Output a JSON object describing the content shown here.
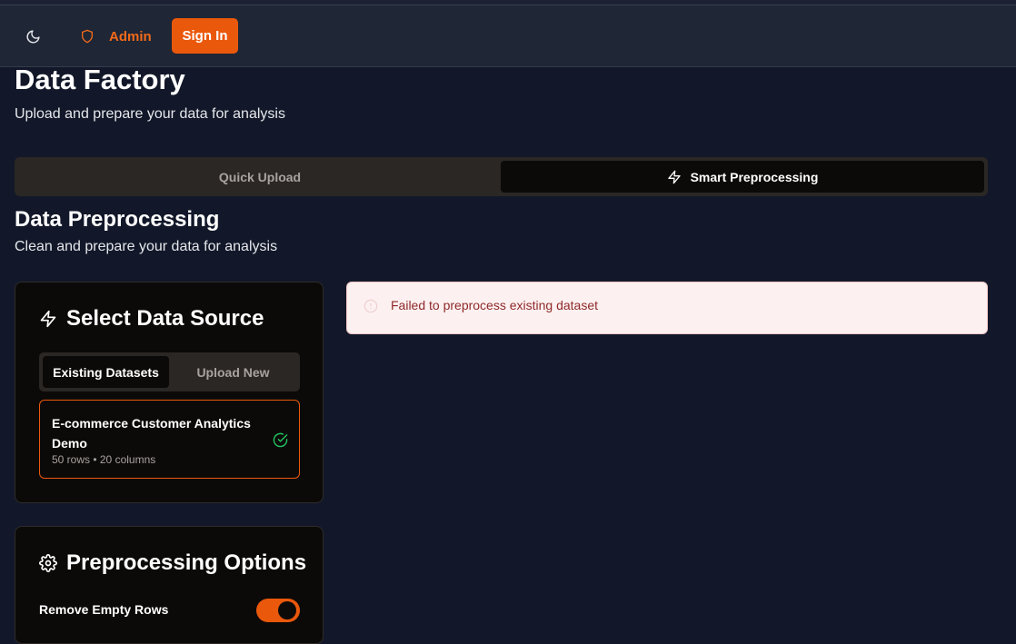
{
  "navbar": {
    "theme_toggle_icon": "moon-icon",
    "admin_icon": "shield-icon",
    "admin_label": "Admin",
    "signin_label": "Sign In"
  },
  "page": {
    "title": "Data Factory",
    "subtitle": "Upload and prepare your data for analysis"
  },
  "mode_tabs": {
    "quick_upload": "Quick Upload",
    "smart_preprocessing": "Smart Preprocessing",
    "active": "smart_preprocessing",
    "smart_icon": "zap-icon"
  },
  "section": {
    "title": "Data Preprocessing",
    "subtitle": "Clean and prepare your data for analysis"
  },
  "data_source": {
    "title": "Select Data Source",
    "title_icon": "zap-icon",
    "tabs": {
      "existing": "Existing Datasets",
      "upload": "Upload New",
      "active": "existing"
    },
    "datasets": [
      {
        "name": "E-commerce Customer Analytics Demo",
        "meta": "50 rows • 20 columns",
        "selected": true
      }
    ]
  },
  "alert": {
    "message": "Failed to preprocess existing dataset",
    "icon": "alert-circle-icon"
  },
  "preprocessing_options": {
    "title": "Preprocessing Options",
    "title_icon": "gear-icon",
    "options": [
      {
        "label": "Remove Empty Rows",
        "enabled": true
      }
    ]
  },
  "colors": {
    "accent": "#ea580c",
    "background": "#121829",
    "card": "#0c0a09",
    "success": "#22c55e",
    "error_text": "#8e2a2a",
    "error_bg": "#fdf0f0"
  }
}
